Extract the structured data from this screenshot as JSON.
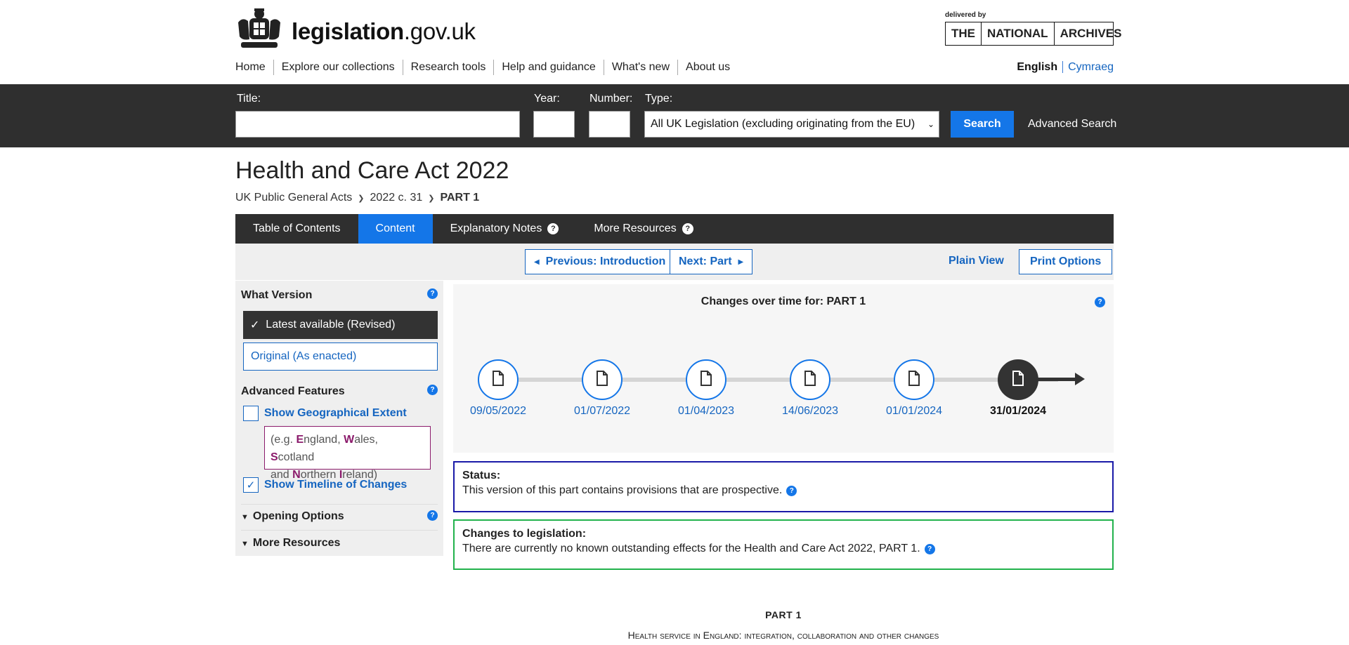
{
  "header": {
    "site_name_bold": "legislation",
    "site_name_rest": ".gov.uk",
    "delivered_by": "delivered by",
    "tna": [
      "THE",
      "NATIONAL",
      "ARCHIVES"
    ]
  },
  "topnav": {
    "items": [
      "Home",
      "Explore our collections",
      "Research tools",
      "Help and guidance",
      "What's new",
      "About us"
    ]
  },
  "language": {
    "english": "English",
    "welsh": "Cymraeg"
  },
  "search": {
    "title_label": "Title:",
    "year_label": "Year:",
    "number_label": "Number:",
    "type_label": "Type:",
    "title_value": "",
    "year_value": "",
    "number_value": "",
    "type_selected": "All UK Legislation (excluding originating from the EU)",
    "search_button": "Search",
    "advanced_link": "Advanced Search"
  },
  "page": {
    "title": "Health and Care Act 2022",
    "breadcrumb": [
      "UK Public General Acts",
      "2022 c. 31",
      "PART 1"
    ]
  },
  "tabs": [
    {
      "label": "Table of Contents"
    },
    {
      "label": "Content"
    },
    {
      "label": "Explanatory Notes"
    },
    {
      "label": "More Resources"
    }
  ],
  "nav": {
    "previous": "Previous: Introduction",
    "next": "Next: Part",
    "plain_view": "Plain View",
    "print_options": "Print Options"
  },
  "sidebar": {
    "what_version": "What Version",
    "latest": "Latest available (Revised)",
    "original": "Original (As enacted)",
    "advanced_features": "Advanced Features",
    "show_geo": "Show Geographical Extent",
    "geo_hint": {
      "open": "(e.g. ",
      "e": "E",
      "e_rest": "ngland, ",
      "w": "W",
      "w_rest": "ales, ",
      "s": "S",
      "s_rest": "cotland",
      "and": "and ",
      "n": "N",
      "n_rest": "orthern ",
      "i": "I",
      "i_rest": "reland)"
    },
    "show_geo_checked": false,
    "show_timeline": "Show Timeline of Changes",
    "show_timeline_checked": true,
    "opening_options": "Opening Options",
    "more_resources": "More Resources"
  },
  "timeline": {
    "title": "Changes over time for: PART 1",
    "dates": [
      "09/05/2022",
      "01/07/2022",
      "01/04/2023",
      "14/06/2023",
      "01/01/2024",
      "31/01/2024"
    ],
    "current_index": 5
  },
  "status": {
    "heading": "Status:",
    "text": "This version of this part contains provisions that are prospective.",
    "border_color": "#1a1aa8"
  },
  "changes": {
    "heading": "Changes to legislation:",
    "text": "There are currently no known outstanding effects for the Health and Care Act 2022, PART 1.",
    "border_color": "#22b24c"
  },
  "content": {
    "part_heading": "PART 1",
    "part_subheading": "Health service in England: integration, collaboration and other changes"
  },
  "colors": {
    "accent": "#1476e8",
    "dark": "#2f2f2f",
    "link": "#1565c0"
  }
}
